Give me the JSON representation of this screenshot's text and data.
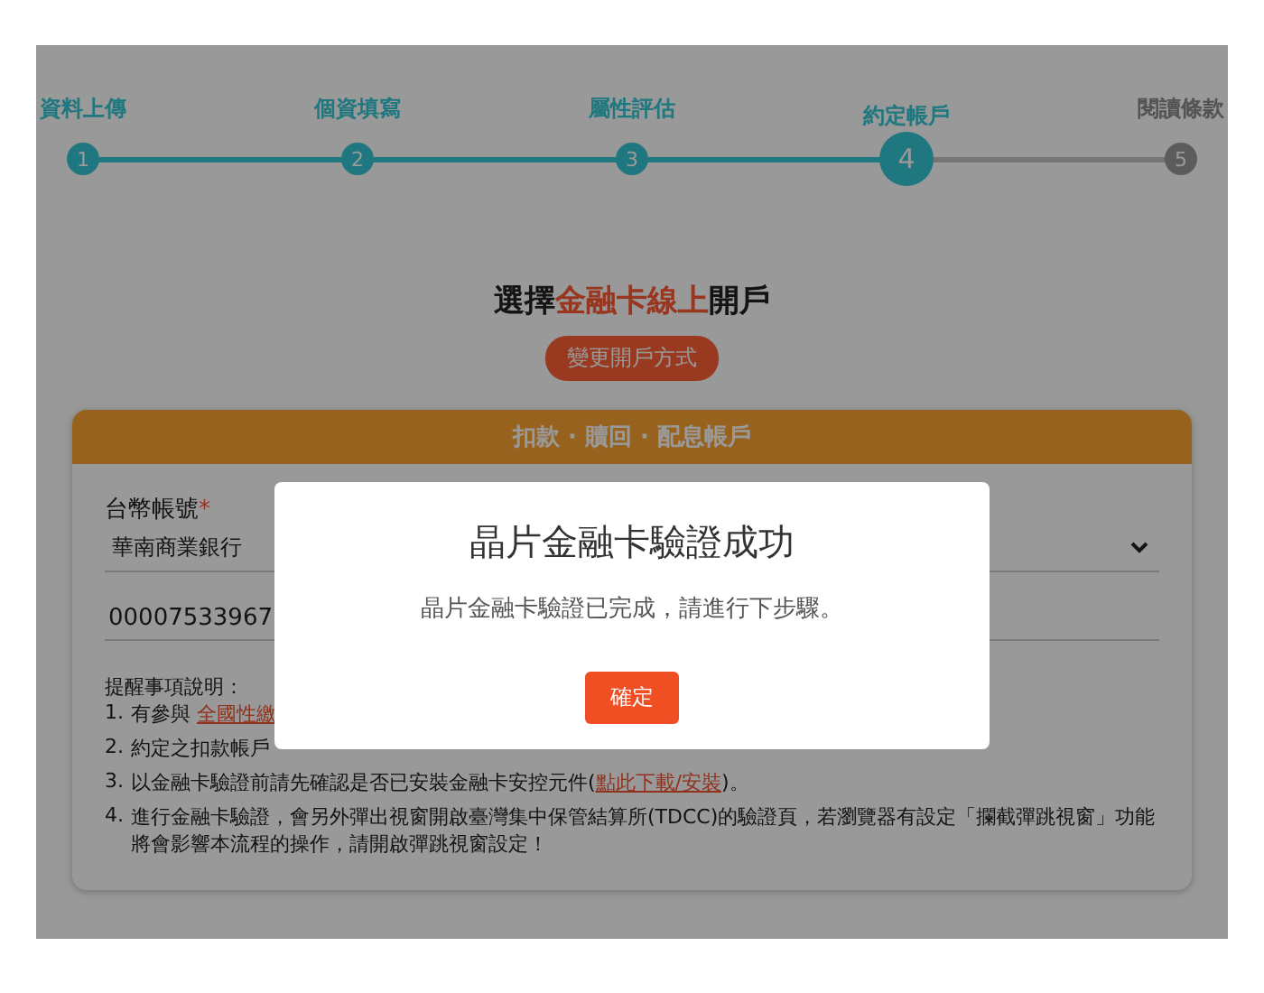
{
  "steps": [
    {
      "label": "資料上傳",
      "number": "1",
      "done": true,
      "selected": false
    },
    {
      "label": "個資填寫",
      "number": "2",
      "done": true,
      "selected": false
    },
    {
      "label": "屬性評估",
      "number": "3",
      "done": true,
      "selected": false
    },
    {
      "label": "約定帳戶",
      "number": "4",
      "done": false,
      "selected": true
    },
    {
      "label": "閱讀條款",
      "number": "5",
      "done": false,
      "selected": false
    }
  ],
  "heading": {
    "prefix": "選擇",
    "highlight": "金融卡線上",
    "suffix": "開戶"
  },
  "change_button": "變更開戶方式",
  "section": {
    "title": "扣款 · 贖回 · 配息帳戶",
    "field_label": "台幣帳號",
    "required_mark": "*",
    "bank_select": "華南商業銀行",
    "account_number": "00007533967",
    "notes_title": "提醒事項說明：",
    "notes": [
      {
        "number": "1.",
        "parts": [
          {
            "kind": "text",
            "text": "有參與 "
          },
          {
            "kind": "link",
            "text": "全國性繳"
          }
        ]
      },
      {
        "number": "2.",
        "parts": [
          {
            "kind": "text",
            "text": "約定之扣款帳戶"
          }
        ]
      },
      {
        "number": "3.",
        "parts": [
          {
            "kind": "text",
            "text": "以金融卡驗證前請先確認是否已安裝金融卡安控元件("
          },
          {
            "kind": "link",
            "text": "點此下載/安裝"
          },
          {
            "kind": "text",
            "text": ")。"
          }
        ]
      },
      {
        "number": "4.",
        "parts": [
          {
            "kind": "text",
            "text": "進行金融卡驗證，會另外彈出視窗開啟臺灣集中保管結算所(TDCC)的驗證頁，若瀏覽器有設定「攔截彈跳視窗」功能將會影響本流程的操作，請開啟彈跳視窗設定！"
          }
        ]
      }
    ]
  },
  "modal": {
    "title": "晶片金融卡驗證成功",
    "message": "晶片金融卡驗證已完成，請進行下步驟。",
    "button": "確定"
  }
}
